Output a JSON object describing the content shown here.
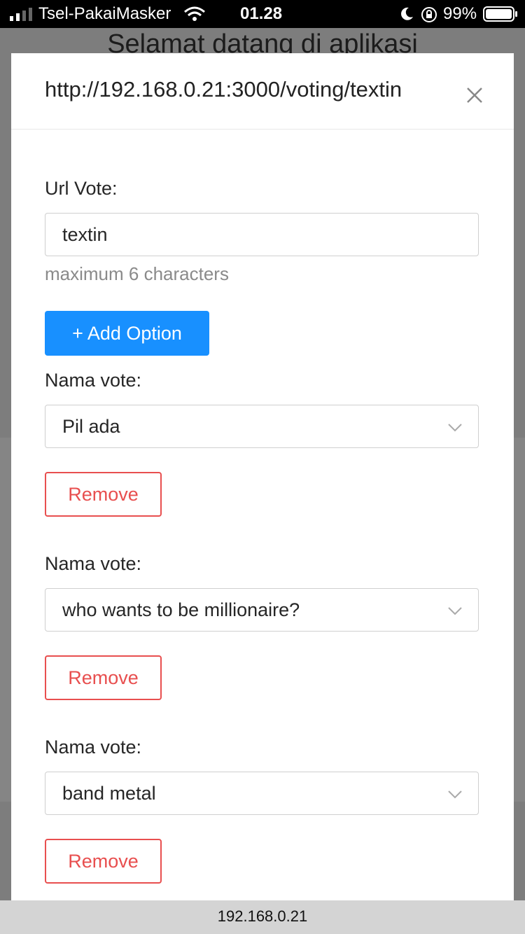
{
  "status_bar": {
    "carrier": "Tsel-PakaiMasker",
    "time": "01.28",
    "battery": "99%"
  },
  "background": {
    "title": "Selamat datang di aplikasi"
  },
  "modal": {
    "title": "http://192.168.0.21:3000/voting/textin",
    "url_vote_label": "Url Vote:",
    "url_vote_value": "textin",
    "hint": "maximum 6 characters",
    "add_option_label": "+ Add Option",
    "options": [
      {
        "label": "Nama vote:",
        "value": "Pil ada",
        "remove": "Remove"
      },
      {
        "label": "Nama vote:",
        "value": "who wants to be millionaire?",
        "remove": "Remove"
      },
      {
        "label": "Nama vote:",
        "value": "band metal",
        "remove": "Remove"
      }
    ]
  },
  "url_bar": {
    "host": "192.168.0.21"
  },
  "colors": {
    "primary": "#1890ff",
    "danger": "#e84f4f"
  },
  "icons": [
    "signal-icon",
    "wifi-icon",
    "moon-icon",
    "rotation-lock-icon",
    "battery-icon",
    "close-icon",
    "chevron-down-icon"
  ]
}
